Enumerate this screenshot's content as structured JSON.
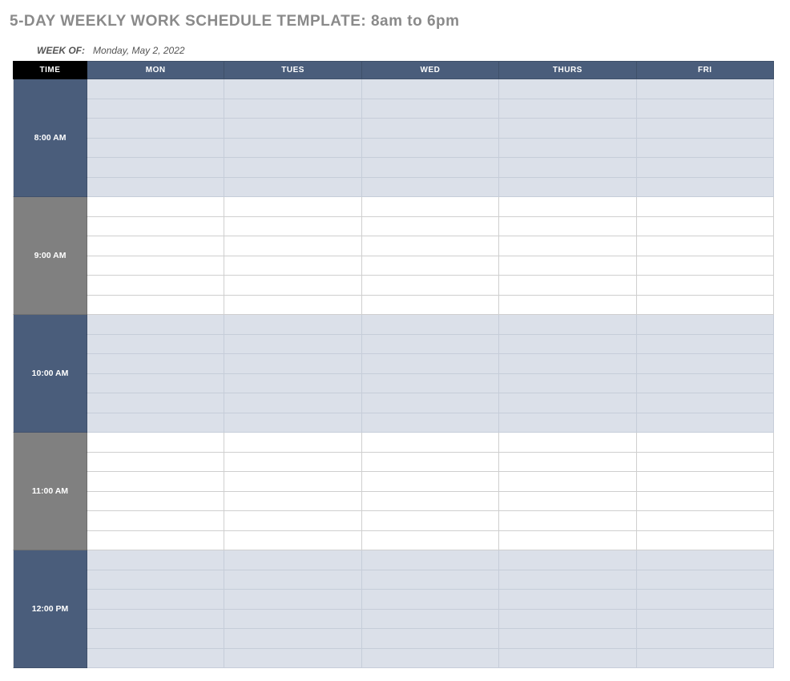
{
  "title": "5-DAY WEEKLY WORK SCHEDULE TEMPLATE: 8am to 6pm",
  "week_of_label": "WEEK OF:",
  "week_of_value": "Monday, May 2, 2022",
  "columns": {
    "time": "TIME",
    "days": [
      "MON",
      "TUES",
      "WED",
      "THURS",
      "FRI"
    ]
  },
  "time_blocks": [
    {
      "label": "8:00 AM",
      "style": "dark",
      "slot_style": "shaded",
      "rows": 6
    },
    {
      "label": "9:00 AM",
      "style": "grey",
      "slot_style": "plain",
      "rows": 6
    },
    {
      "label": "10:00 AM",
      "style": "dark",
      "slot_style": "shaded",
      "rows": 6
    },
    {
      "label": "11:00 AM",
      "style": "grey",
      "slot_style": "plain",
      "rows": 6
    },
    {
      "label": "12:00 PM",
      "style": "dark",
      "slot_style": "shaded",
      "rows": 6
    }
  ]
}
